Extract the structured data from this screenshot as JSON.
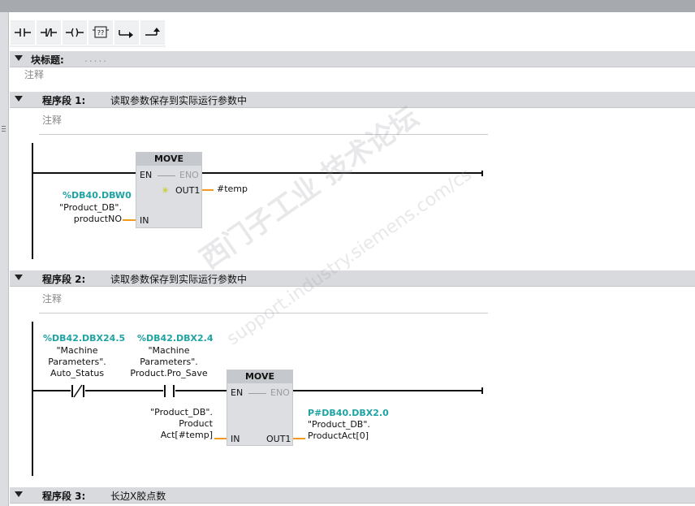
{
  "toolbar": {
    "items": [
      {
        "icon": "no-contact-icon"
      },
      {
        "icon": "nc-contact-icon"
      },
      {
        "icon": "coil-icon"
      },
      {
        "icon": "empty-box-icon",
        "glyph": "??"
      },
      {
        "icon": "open-branch-icon"
      },
      {
        "icon": "close-branch-icon"
      }
    ]
  },
  "block": {
    "title_label": "块标题:",
    "title_value": ".....",
    "comment": "注释"
  },
  "networks": [
    {
      "label": "程序段 1:",
      "title": "读取参数保存到实际运行参数中",
      "comment": "注释",
      "move": {
        "name": "MOVE",
        "en": "EN",
        "eno": "ENO",
        "out": "OUT1",
        "in": "IN"
      },
      "in_addr": "%DB40.DBW0",
      "in_sym1": "\"Product_DB\".",
      "in_sym2": "productNO",
      "out_value": "#temp"
    },
    {
      "label": "程序段 2:",
      "title": "读取参数保存到实际运行参数中",
      "comment": "注释",
      "contact1": {
        "addr": "%DB42.DBX24.5",
        "sym1": "\"Machine",
        "sym2": "Parameters\".",
        "sym3": "Auto_Status"
      },
      "contact2": {
        "addr": "%DB42.DBX2.4",
        "sym1": "\"Machine",
        "sym2": "Parameters\".",
        "sym3": "Product.Pro_Save"
      },
      "move": {
        "name": "MOVE",
        "en": "EN",
        "eno": "ENO",
        "out": "OUT1",
        "in": "IN"
      },
      "in_sym1": "\"Product_DB\".",
      "in_sym2": "Product",
      "in_sym3": "Act[#temp]",
      "out_addr": "P#DB40.DBX2.0",
      "out_sym1": "\"Product_DB\".",
      "out_sym2": "ProductAct[0]"
    },
    {
      "label": "程序段 3:",
      "title": "长边X胶点数"
    }
  ],
  "watermark": {
    "line1": "西门子工业  技术论坛",
    "line2": "support.industry.siemens.com/cs"
  },
  "colors": {
    "address": "#1fa3a3",
    "wire_orange": "#f39a1d",
    "section_bar": "#d8dadd"
  }
}
